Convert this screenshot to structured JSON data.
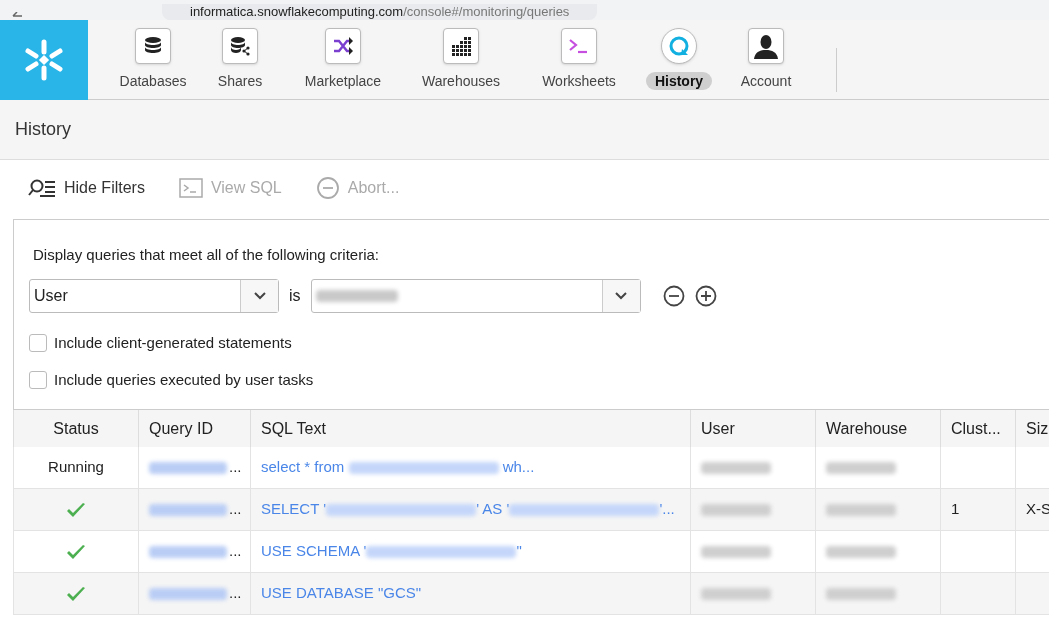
{
  "browser": {
    "url_host": "informatica.snowflakecomputing.com",
    "url_path": "/console#/monitoring/queries"
  },
  "nav": [
    {
      "label": "Databases",
      "kind": "database",
      "selected": false
    },
    {
      "label": "Shares",
      "kind": "share",
      "selected": false
    },
    {
      "label": "Marketplace",
      "kind": "shuffle",
      "selected": false
    },
    {
      "label": "Warehouses",
      "kind": "grid",
      "selected": false
    },
    {
      "label": "Worksheets",
      "kind": "terminal",
      "selected": false
    },
    {
      "label": "History",
      "kind": "history",
      "selected": true
    },
    {
      "label": "Account",
      "kind": "person",
      "selected": false
    }
  ],
  "page_title": "History",
  "toolbar": [
    {
      "label": "Hide Filters",
      "kind": "filter",
      "disabled": false
    },
    {
      "label": "View SQL",
      "kind": "sql",
      "disabled": true
    },
    {
      "label": "Abort...",
      "kind": "abort",
      "disabled": true
    }
  ],
  "filters": {
    "heading": "Display queries that meet all of the following criteria:",
    "field": "User",
    "operator": "is",
    "options": [
      {
        "label": "Include client-generated statements",
        "checked": false
      },
      {
        "label": "Include queries executed by user tasks",
        "checked": false
      }
    ]
  },
  "table": {
    "columns": [
      "Status",
      "Query ID",
      "SQL Text",
      "User",
      "Warehouse",
      "Clust...",
      "Siz"
    ],
    "rows": [
      {
        "status": {
          "kind": "text",
          "text": "Running"
        },
        "query_id_suffix": "...",
        "sql": [
          {
            "kind": "text",
            "text": "select * from "
          },
          {
            "kind": "redacted"
          },
          {
            "kind": "text",
            "text": " wh..."
          }
        ],
        "cluster": "",
        "size": ""
      },
      {
        "status": {
          "kind": "success"
        },
        "query_id_suffix": "...",
        "sql": [
          {
            "kind": "text",
            "text": "SELECT '"
          },
          {
            "kind": "redacted"
          },
          {
            "kind": "text",
            "text": "' AS '"
          },
          {
            "kind": "redacted"
          },
          {
            "kind": "text",
            "text": "'..."
          }
        ],
        "cluster": "1",
        "size": "X-S"
      },
      {
        "status": {
          "kind": "success"
        },
        "query_id_suffix": "...",
        "sql": [
          {
            "kind": "text",
            "text": "USE SCHEMA '"
          },
          {
            "kind": "redacted"
          },
          {
            "kind": "text",
            "text": "\""
          }
        ],
        "cluster": "",
        "size": ""
      },
      {
        "status": {
          "kind": "success"
        },
        "query_id_suffix": "...",
        "sql": [
          {
            "kind": "text",
            "text": "USE DATABASE \"GCS\""
          }
        ],
        "cluster": "",
        "size": ""
      }
    ]
  }
}
